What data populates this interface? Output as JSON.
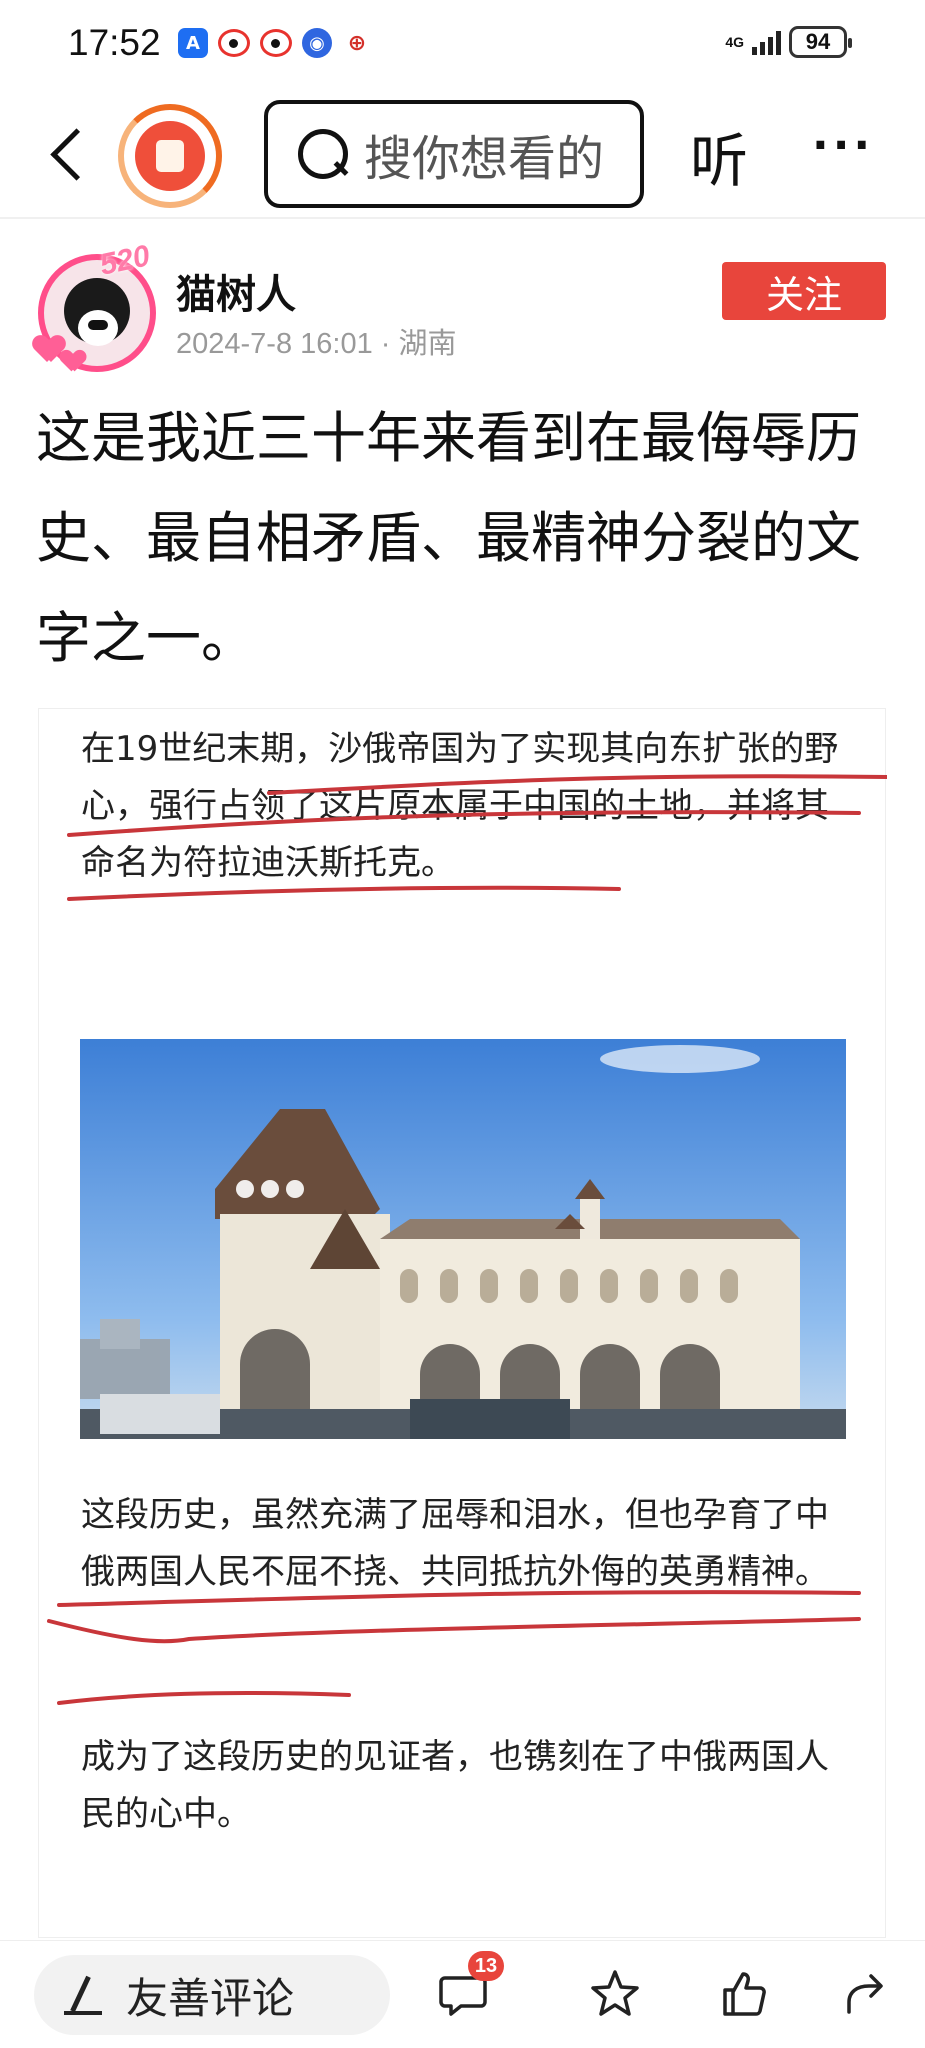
{
  "status": {
    "time": "17:52",
    "network": "4G",
    "battery": "94",
    "notification_icons": [
      "app-store-icon",
      "weibo-icon",
      "weibo-icon",
      "browser-icon",
      "miaopai-icon"
    ]
  },
  "nav": {
    "search_placeholder": "搜你想看的",
    "listen_label": "听",
    "more_label": "···"
  },
  "author": {
    "name": "猫树人",
    "avatar_badge": "520",
    "meta": "2024-7-8 16:01 · 湖南",
    "follow_label": "关注"
  },
  "post": {
    "title": "这是我近三十年来看到在最侮辱历史、最自相矛盾、最精神分裂的文字之一。",
    "paragraphs": [
      "在19世纪末期，沙俄帝国为了实现其向东扩张的野心，强行占领了这片原本属于中国的土地，并将其命名为符拉迪沃斯托克。",
      "这段历史，虽然充满了屈辱和泪水，但也孕育了中俄两国人民不屈不挠、共同抵抗外侮的英勇精神。",
      "成为了这段历史的见证者，也镌刻在了中俄两国人民的心中。"
    ],
    "photo_alt": "railway-station-building"
  },
  "bottom": {
    "comment_label": "友善评论",
    "comment_count": "13"
  },
  "colors": {
    "accent_red": "#e8453c",
    "underline_red": "#c8363a",
    "avatar_pink": "#ff4e8a"
  }
}
